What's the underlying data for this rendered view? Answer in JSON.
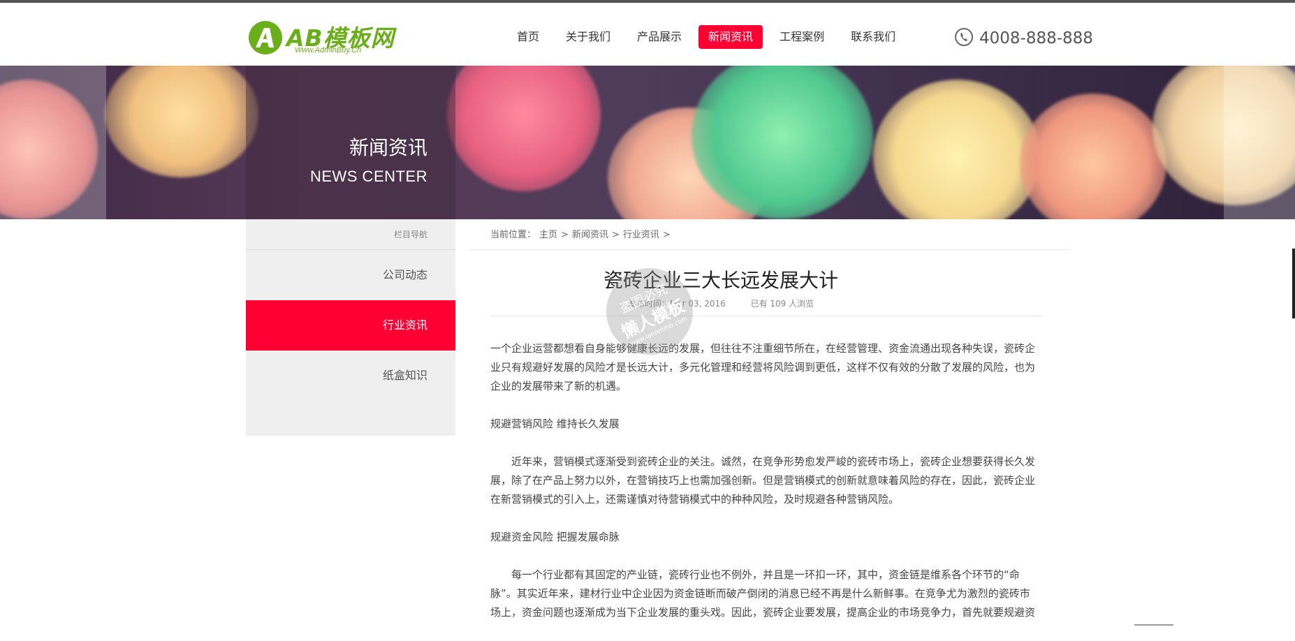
{
  "logo": {
    "title": "AB模板网",
    "subtitle": "Www.AdminBuy.Cn",
    "mark": "A"
  },
  "nav": {
    "items": [
      {
        "label": "首页"
      },
      {
        "label": "关于我们"
      },
      {
        "label": "产品展示"
      },
      {
        "label": "新闻资讯",
        "active": true
      },
      {
        "label": "工程案例"
      },
      {
        "label": "联系我们"
      }
    ]
  },
  "phone": {
    "icon": "phone-icon",
    "number": "4008-888-888"
  },
  "banner": {
    "title": "新闻资讯",
    "subtitle": "NEWS CENTER"
  },
  "sidebar": {
    "heading": "栏目导航",
    "items": [
      {
        "label": "公司动态"
      },
      {
        "label": "行业资讯",
        "active": true
      },
      {
        "label": "纸盒知识"
      }
    ]
  },
  "breadcrumb": {
    "prefix": "当前位置：",
    "items": [
      "主页",
      "新闻资讯",
      "行业资讯"
    ],
    "sep": ">"
  },
  "article": {
    "title": "瓷砖企业三大长远发展大计",
    "publish_label": "发布时间：Mar 03, 2016",
    "views_label": "已有 109 人浏览",
    "paragraphs": [
      "一个企业运营都想看自身能够健康长远的发展，但往往不注重细节所在，在经营管理、资金流通出现各种失误，瓷砖企业只有规避好发展的风险才是长远大计，多元化管理和经营将风险调到更低，这样不仅有效的分散了发展的风险，也为企业的发展带来了新的机遇。",
      "规避营销风险 维持长久发展",
      "近年来，营销模式逐渐受到瓷砖企业的关注。诚然，在竞争形势愈发严峻的瓷砖市场上，瓷砖企业想要获得长久发展，除了在产品上努力以外，在营销技巧上也需加强创新。但是营销模式的创新就意味着风险的存在，因此，瓷砖企业在新营销模式的引入上，还需谨慎对待营销模式中的种种风险，及时规避各种营销风险。",
      "规避资金风险 把握发展命脉",
      "每一个行业都有其固定的产业链，瓷砖行业也不例外，并且是一环扣一环，其中，资金链是维系各个环节的“命脉”。其实近年来，建材行业中企业因为资金链断而破产倒闭的消息已经不再是什么新鲜事。在竞争尤为激烈的瓷砖市场上，资金问题也逐渐成为当下企业发展的重头戏。因此，瓷砖企业要发展，提高企业的市场竞争力，首先就要规避资"
    ]
  },
  "watermark": {
    "line1": "盗图必究",
    "line2": "懒人模板",
    "line3": "www.lanrenmb.com"
  },
  "colors": {
    "accent": "#ff0033",
    "logo_green": "#6aae1a"
  }
}
